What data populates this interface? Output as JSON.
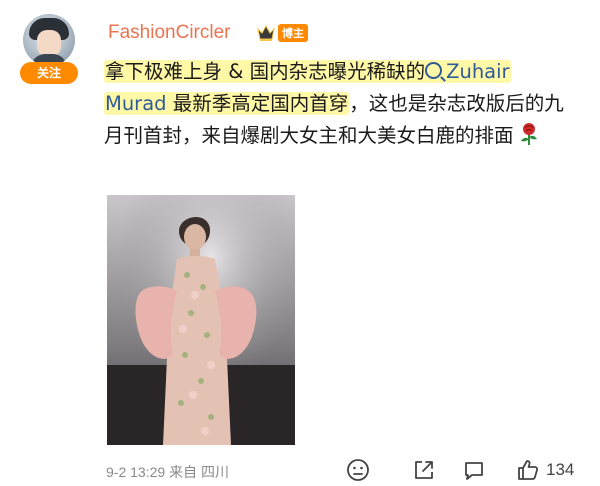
{
  "user": {
    "name": "FashionCircler",
    "blogger_tag": "博主",
    "follow_label": "关注"
  },
  "post": {
    "text_prefix": "拿下极难上身 & 国内杂志曝光稀缺的",
    "topic_line1": "Zuhair",
    "topic_line2": "Murad",
    "text_highlight_tail": " 最新季高定国内首穿",
    "text_rest": "，这也是杂志改版后的九月刊首封，来自爆剧大女主和大美女白鹿的排面",
    "emoji": "rose-icon"
  },
  "meta": {
    "date": "9-2 13:29",
    "source": "来自 四川"
  },
  "actions": {
    "like_count": "134"
  },
  "colors": {
    "username": "#eb7350",
    "accent": "#ff8a00",
    "highlight": "#fff8a6",
    "link": "#2f5c99"
  }
}
